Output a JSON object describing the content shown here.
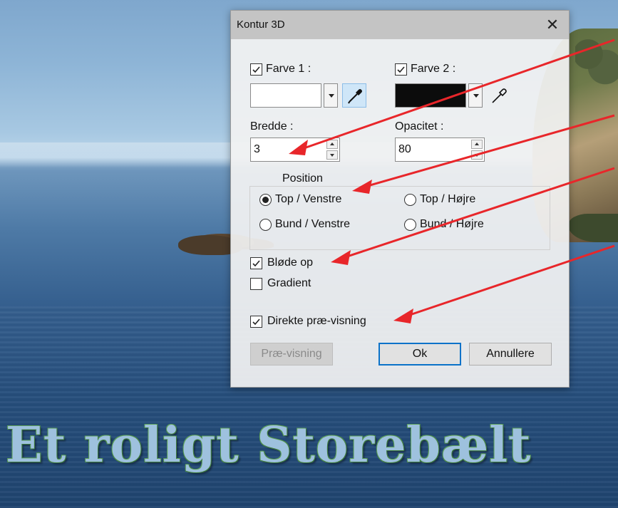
{
  "background": {
    "headline": "Et roligt Storebælt"
  },
  "dialog": {
    "title": "Kontur 3D",
    "close_glyph": "✕",
    "color1": {
      "label": "Farve 1 :",
      "checked": true,
      "swatch": "#ffffff"
    },
    "color2": {
      "label": "Farve 2 :",
      "checked": true,
      "swatch": "#0c0c0c"
    },
    "width": {
      "label": "Bredde :",
      "value": "3"
    },
    "opacity": {
      "label": "Opacitet :",
      "value": "80"
    },
    "position": {
      "legend": "Position",
      "options": [
        {
          "label": "Top / Venstre",
          "selected": true
        },
        {
          "label": "Top / Højre",
          "selected": false
        },
        {
          "label": "Bund / Venstre",
          "selected": false
        },
        {
          "label": "Bund / Højre",
          "selected": false
        }
      ]
    },
    "soften": {
      "label": "Bløde op",
      "checked": true
    },
    "gradient": {
      "label": "Gradient",
      "checked": false
    },
    "live_preview": {
      "label": "Direkte præ-visning",
      "checked": true
    },
    "buttons": {
      "preview": "Præ-visning",
      "ok": "Ok",
      "cancel": "Annullere"
    }
  },
  "annotation_color": "#e8262a"
}
